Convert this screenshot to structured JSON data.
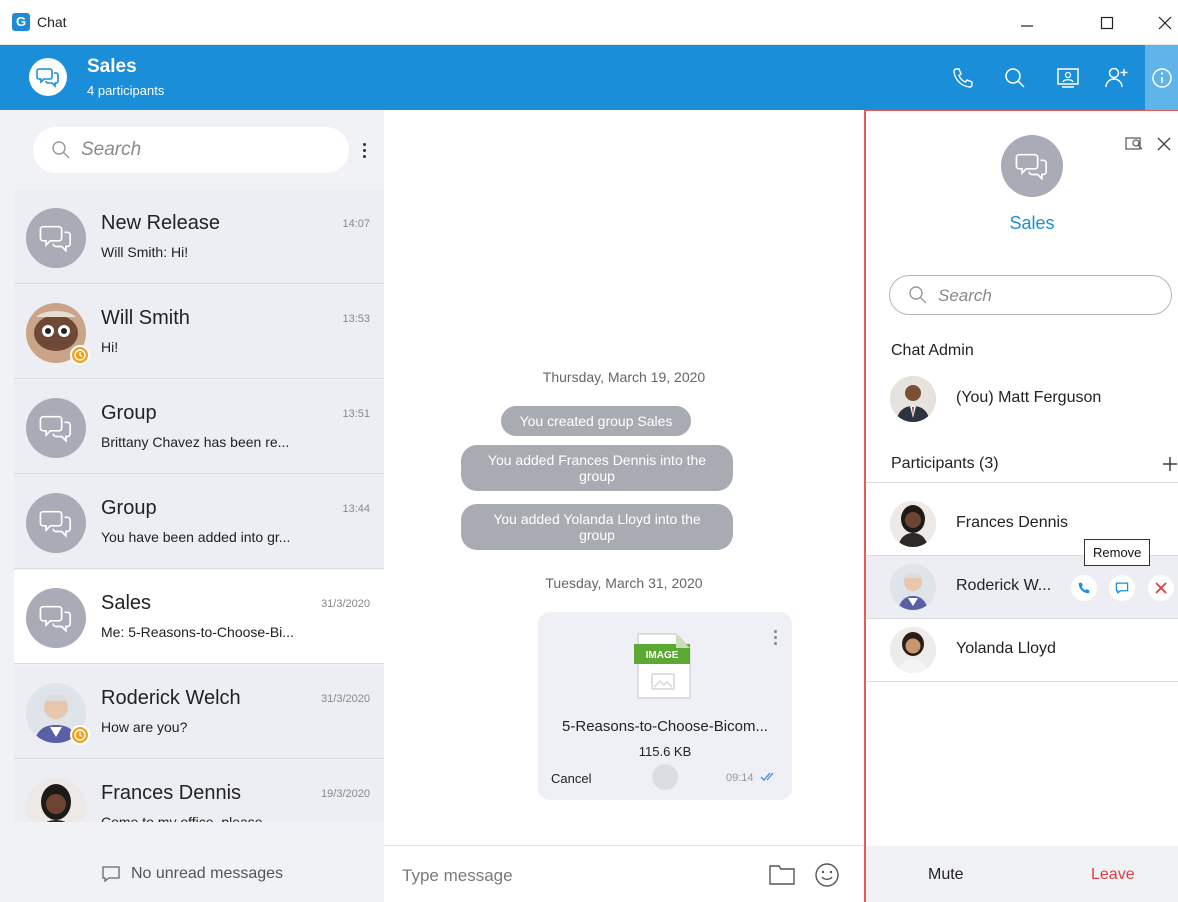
{
  "window": {
    "title": "Chat",
    "app_logo": "G"
  },
  "header": {
    "title": "Sales",
    "subtitle": "4 participants"
  },
  "left": {
    "search_placeholder": "Search",
    "chats": [
      {
        "name": "New Release",
        "last": "Will Smith: Hi!",
        "time": "14:07",
        "type": "group"
      },
      {
        "name": "Will Smith",
        "last": "Hi!",
        "time": "13:53",
        "type": "person"
      },
      {
        "name": "Group",
        "last": "Brittany Chavez has been re...",
        "time": "13:51",
        "type": "group"
      },
      {
        "name": "Group",
        "last": "You have been added into gr...",
        "time": "13:44",
        "type": "group"
      },
      {
        "name": "Sales",
        "last": "Me: 5-Reasons-to-Choose-Bi...",
        "time": "31/3/2020",
        "type": "group"
      },
      {
        "name": "Roderick Welch",
        "last": "How are you?",
        "time": "31/3/2020",
        "type": "person"
      },
      {
        "name": "Frances Dennis",
        "last": "Come to my office, please",
        "time": "19/3/2020",
        "type": "person"
      }
    ],
    "footer": "No unread messages"
  },
  "conversation": {
    "date1": "Thursday, March 19, 2020",
    "msg1": "You created group Sales",
    "msg2": "You added Frances Dennis into the group",
    "msg3": "You added Yolanda Lloyd into the group",
    "date2": "Tuesday, March 31, 2020",
    "file": {
      "badge": "IMAGE",
      "name": "5-Reasons-to-Choose-Bicom...",
      "size": "115.6 KB",
      "cancel": "Cancel",
      "time": "09:14"
    },
    "input_placeholder": "Type message"
  },
  "info": {
    "title": "Sales",
    "search_placeholder": "Search",
    "admin_label": "Chat Admin",
    "admin_name": "(You) Matt Ferguson",
    "participants_label": "Participants (3)",
    "participants": [
      {
        "name": "Frances Dennis"
      },
      {
        "name": "Roderick W..."
      },
      {
        "name": "Yolanda Lloyd"
      }
    ],
    "tooltip": "Remove",
    "mute": "Mute",
    "leave": "Leave"
  },
  "colors": {
    "accent": "#1a8ed8",
    "danger": "#e23c3c",
    "away": "#f0a01e"
  }
}
